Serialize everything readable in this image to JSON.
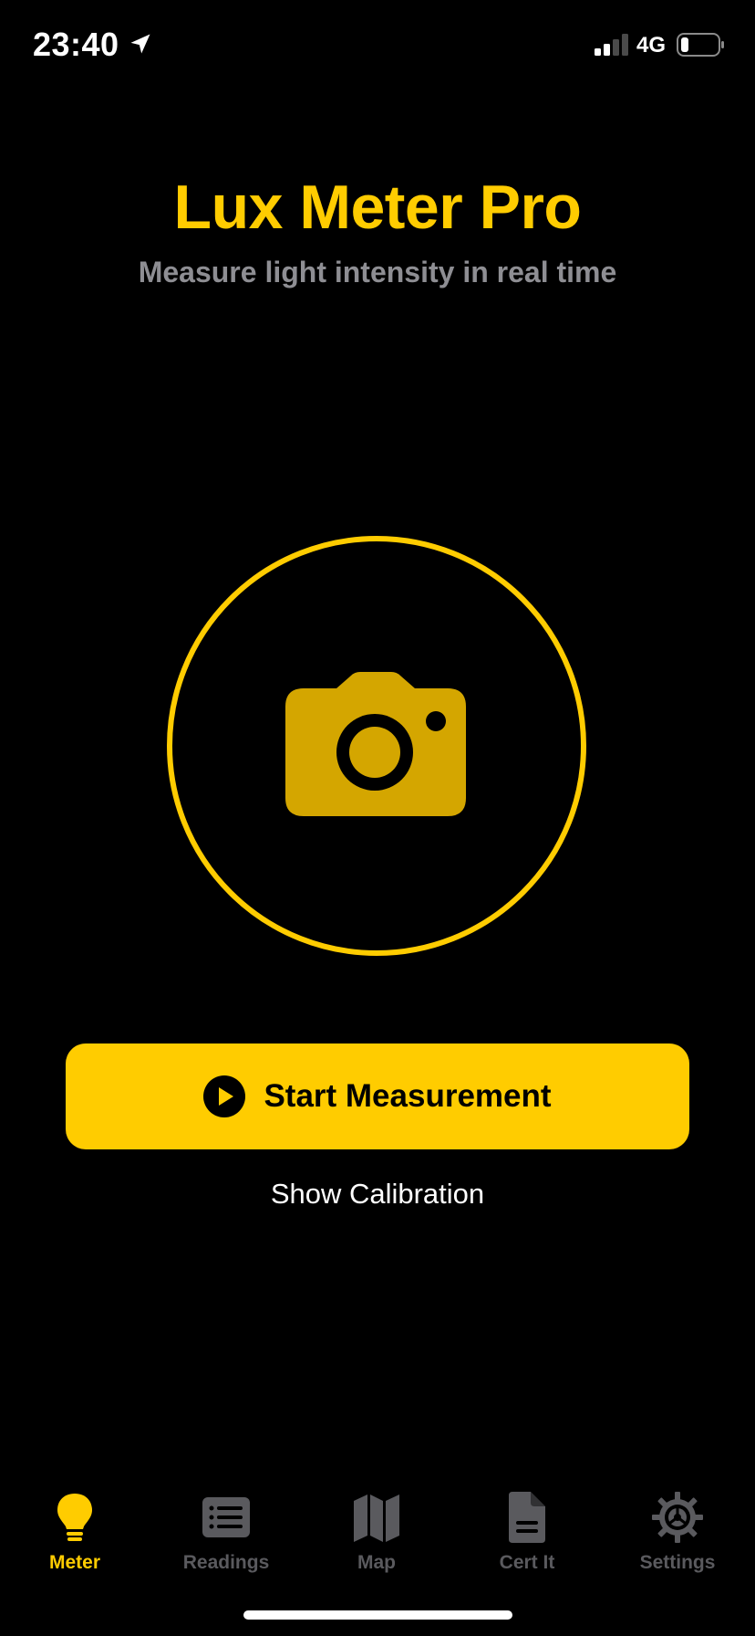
{
  "status_bar": {
    "time": "23:40",
    "network": "4G"
  },
  "header": {
    "title": "Lux Meter Pro",
    "subtitle": "Measure light intensity in real time"
  },
  "main": {
    "start_label": "Start Measurement",
    "calibration_label": "Show Calibration"
  },
  "tabs": [
    {
      "label": "Meter",
      "icon": "lightbulb-icon",
      "active": true
    },
    {
      "label": "Readings",
      "icon": "list-icon",
      "active": false
    },
    {
      "label": "Map",
      "icon": "map-icon",
      "active": false
    },
    {
      "label": "Cert It",
      "icon": "document-icon",
      "active": false
    },
    {
      "label": "Settings",
      "icon": "gear-icon",
      "active": false
    }
  ],
  "colors": {
    "accent": "#FFCC00",
    "camera_fill": "#D4A600",
    "inactive_tab": "#5A5A5E",
    "subtitle": "#8E8E93",
    "background": "#000000"
  }
}
